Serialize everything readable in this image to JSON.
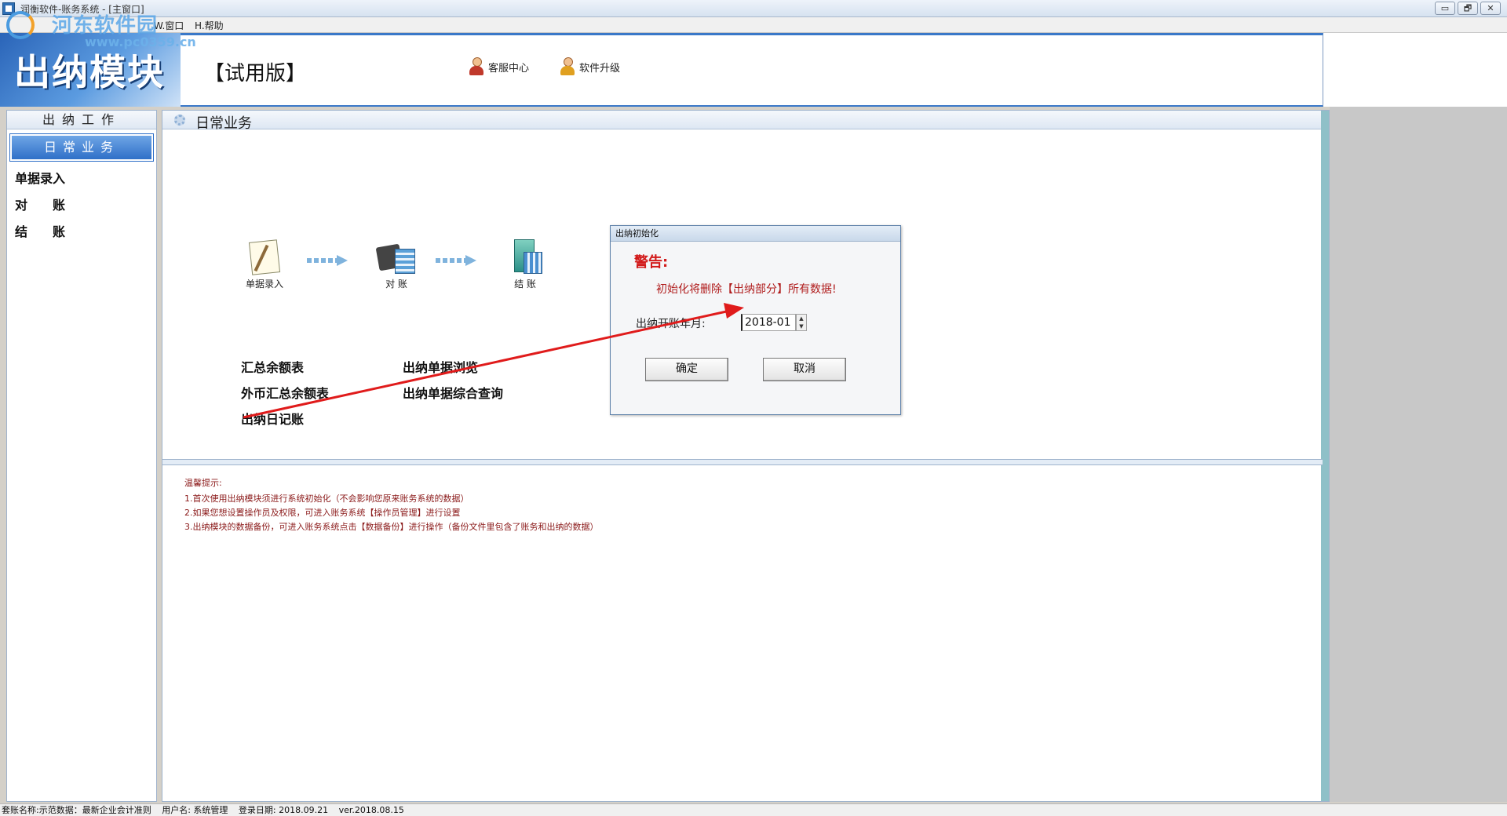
{
  "window": {
    "title": "润衡软件-账务系统 - [主窗口]",
    "controls": [
      "▭",
      "🗗",
      "✕"
    ]
  },
  "watermark": {
    "text": "河东软件园",
    "url": "www.pc0359.cn"
  },
  "menu": {
    "items": [
      "W.窗口",
      "H.帮助"
    ]
  },
  "header": {
    "banner_title": "出纳模块",
    "edition": "【试用版】",
    "service_label": "客服中心",
    "upgrade_label": "软件升级"
  },
  "left_panel": {
    "title": "出纳工作",
    "active_item": "日常业务",
    "items": [
      "单据录入",
      "对　　账",
      "结　　账"
    ]
  },
  "main_panel": {
    "title": "日常业务",
    "flow": [
      "单据录入",
      "对 账",
      "结 账"
    ],
    "reports_left": [
      "汇总余额表",
      "外币汇总余额表",
      "出纳日记账"
    ],
    "reports_right": [
      "出纳单据浏览",
      "出纳单据综合查询"
    ]
  },
  "tips": {
    "title": "温馨提示:",
    "lines": [
      "1.首次使用出纳模块须进行系统初始化（不会影响您原来账务系统的数据）",
      "2.如果您想设置操作员及权限，可进入账务系统【操作员管理】进行设置",
      "3.出纳模块的数据备份，可进入账务系统点击【数据备份】进行操作（备份文件里包含了账务和出纳的数据）"
    ]
  },
  "dialog": {
    "title": "出纳初始化",
    "warning_title": "警告:",
    "warning_message": "初始化将删除【出纳部分】所有数据!",
    "start_label": "出纳开账年月:",
    "start_value": "2018-01",
    "ok_label": "确定",
    "cancel_label": "取消"
  },
  "status_bar": {
    "account_set": "套账名称:示范数据：最新企业会计准则",
    "user": "用户名: 系统管理",
    "login_date": "登录日期: 2018.09.21",
    "version": "ver.2018.08.15"
  },
  "colors": {
    "accent_blue": "#2f6fc8",
    "warning_red": "#d21a1a",
    "tips_red": "#8b1a1a",
    "annotation_arrow": "#e01b1b"
  }
}
